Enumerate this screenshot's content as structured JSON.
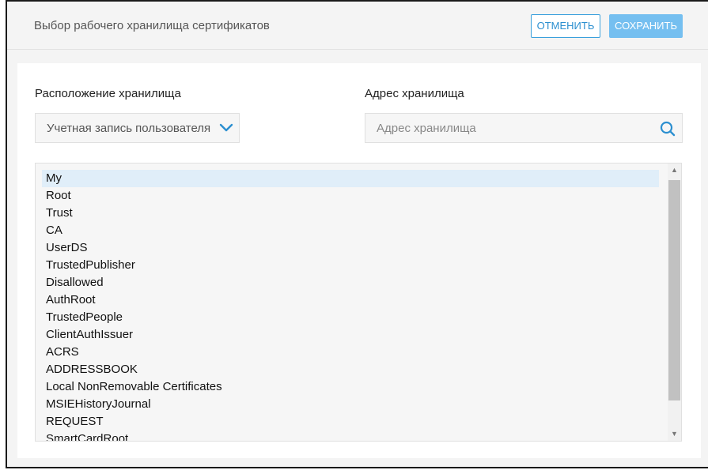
{
  "header": {
    "title": "Выбор рабочего хранилища сертификатов",
    "cancel_label": "ОТМЕНИТЬ",
    "save_label": "СОХРАНИТЬ"
  },
  "location": {
    "label": "Расположение хранилища",
    "value": "Учетная запись пользователя",
    "icon": "chevron-down-icon"
  },
  "address": {
    "label": "Адрес хранилища",
    "placeholder": "Адрес хранилища",
    "icon": "search-icon"
  },
  "stores": {
    "selected_index": 0,
    "items": [
      "My",
      "Root",
      "Trust",
      "CA",
      "UserDS",
      "TrustedPublisher",
      "Disallowed",
      "AuthRoot",
      "TrustedPeople",
      "ClientAuthIssuer",
      "ACRS",
      "ADDRESSBOOK",
      "Local NonRemovable Certificates",
      "MSIEHistoryJournal",
      "REQUEST",
      "SmartCardRoot"
    ]
  },
  "colors": {
    "accent": "#2b8fd0",
    "save_button": "#75bff0",
    "selected_row": "#e0eef9"
  }
}
